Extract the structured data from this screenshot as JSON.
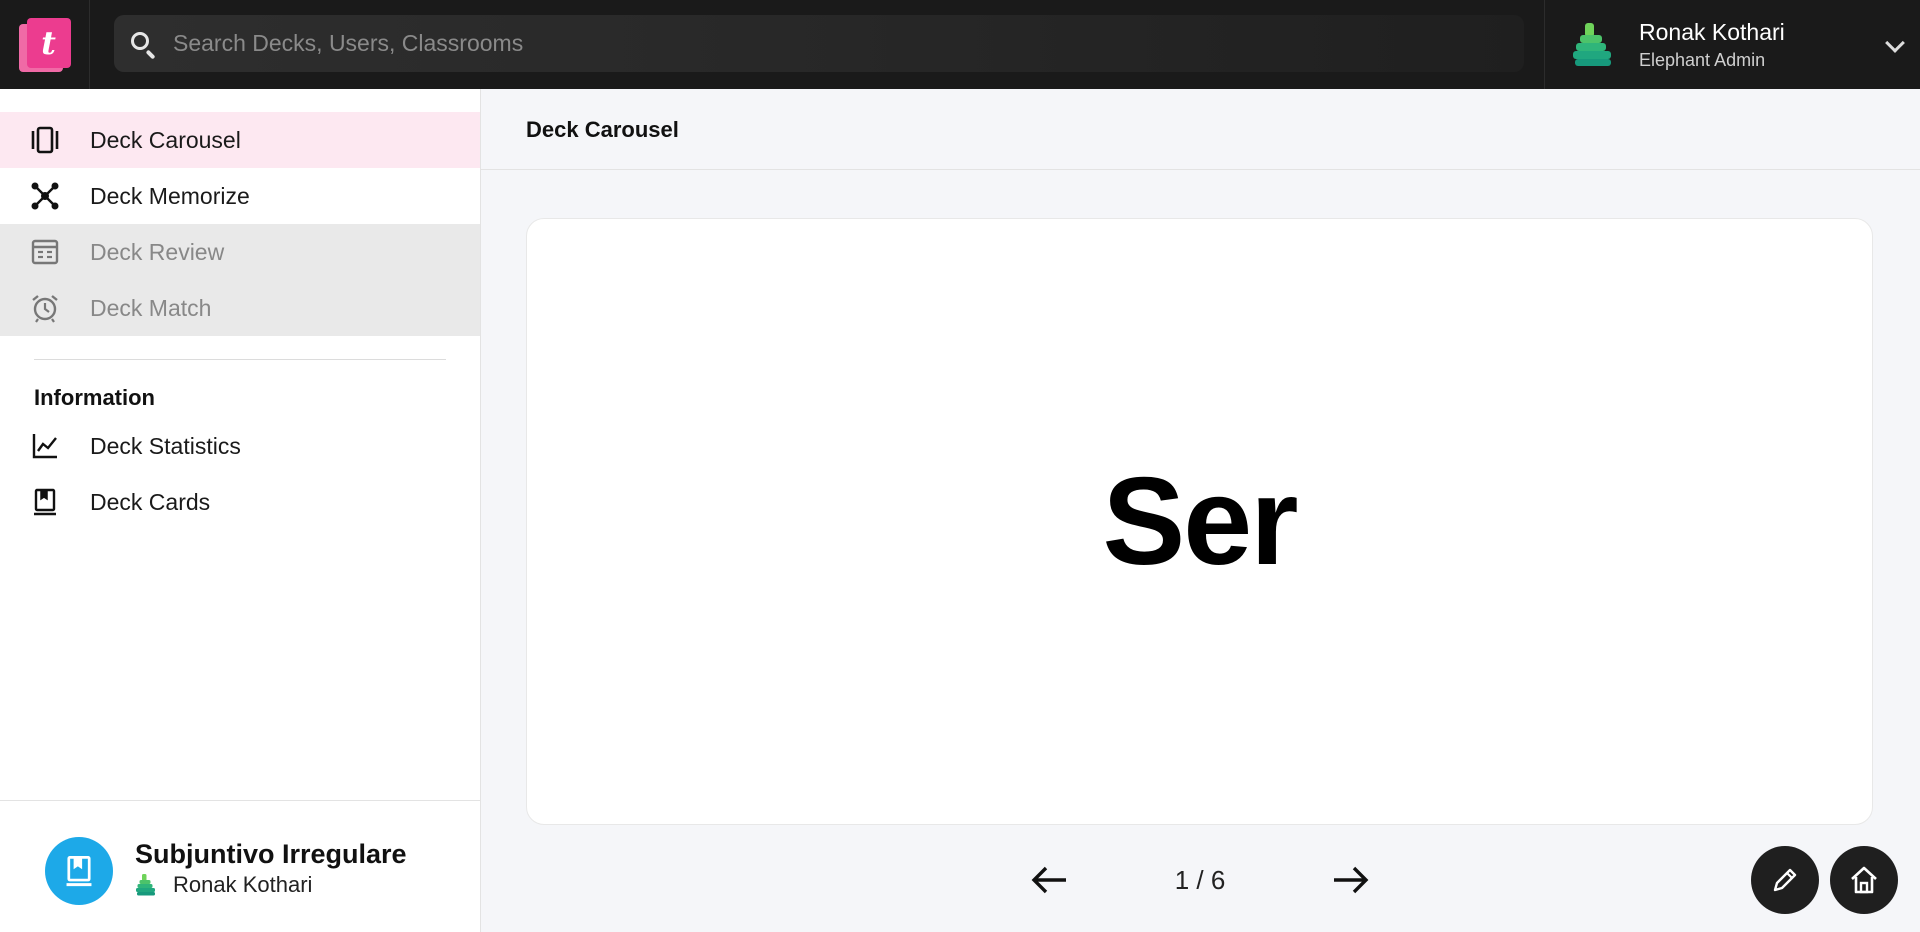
{
  "app": {
    "logo_glyph": "t"
  },
  "search": {
    "placeholder": "Search Decks, Users, Classrooms"
  },
  "user": {
    "name": "Ronak Kothari",
    "role": "Elephant Admin"
  },
  "sidebar": {
    "items": [
      {
        "label": "Deck Carousel",
        "icon": "carousel-icon",
        "state": "active"
      },
      {
        "label": "Deck Memorize",
        "icon": "hub-icon",
        "state": "normal"
      },
      {
        "label": "Deck Review",
        "icon": "review-sheet-icon",
        "state": "disabled"
      },
      {
        "label": "Deck Match",
        "icon": "alarm-clock-icon",
        "state": "disabled"
      }
    ],
    "section_title": "Information",
    "info_items": [
      {
        "label": "Deck Statistics",
        "icon": "line-chart-icon"
      },
      {
        "label": "Deck Cards",
        "icon": "bookmark-book-icon"
      }
    ]
  },
  "deck": {
    "title": "Subjuntivo Irregulare",
    "owner": "Ronak Kothari",
    "icon": "book-icon"
  },
  "main": {
    "title": "Deck Carousel"
  },
  "card": {
    "text": "Ser"
  },
  "pager": {
    "text": "1 / 6",
    "current": 1,
    "total": 6
  },
  "colors": {
    "accent": "#ec3c8f",
    "active_bg": "#fde8f1",
    "badge": "#1da9e8",
    "topbar": "#1a1a1a"
  }
}
